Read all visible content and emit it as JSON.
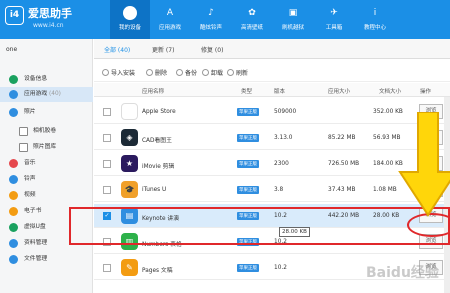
{
  "header": {
    "logo_mark": "i4",
    "brand": "爱思助手",
    "site": "www.i4.cn",
    "nav": [
      {
        "label": "我的设备",
        "icon": "apple-icon",
        "glyph": "",
        "active": true
      },
      {
        "label": "应用游戏",
        "icon": "app-store-icon",
        "glyph": "A",
        "active": false
      },
      {
        "label": "酷炫铃声",
        "icon": "bell-icon",
        "glyph": "♪",
        "active": false
      },
      {
        "label": "高清壁纸",
        "icon": "flower-icon",
        "glyph": "✿",
        "active": false
      },
      {
        "label": "刷机越狱",
        "icon": "box-icon",
        "glyph": "▣",
        "active": false
      },
      {
        "label": "工具箱",
        "icon": "toolbox-icon",
        "glyph": "✈",
        "active": false
      },
      {
        "label": "教程中心",
        "icon": "info-icon",
        "glyph": "i",
        "active": false
      }
    ]
  },
  "sidebar": {
    "device": "one",
    "items": [
      {
        "label": "设备信息",
        "count": "",
        "icon": "info-icon",
        "color": "#1aa15f",
        "sub": false,
        "selected": false
      },
      {
        "label": "应用游戏",
        "count": "(40)",
        "icon": "app-icon",
        "color": "#2f8ee0",
        "sub": false,
        "selected": true
      },
      {
        "label": "照片",
        "count": "",
        "icon": "photo-icon",
        "color": "#2f8ee0",
        "sub": false,
        "selected": false
      },
      {
        "label": "相机胶卷",
        "count": "",
        "icon": "camera-roll-icon",
        "color": "#fff",
        "sub": true,
        "selected": false
      },
      {
        "label": "照片图库",
        "count": "",
        "icon": "photo-library-icon",
        "color": "#fff",
        "sub": true,
        "selected": false
      },
      {
        "label": "音乐",
        "count": "",
        "icon": "music-icon",
        "color": "#e5484d",
        "sub": false,
        "selected": false
      },
      {
        "label": "铃声",
        "count": "",
        "icon": "ringtone-icon",
        "color": "#2f8ee0",
        "sub": false,
        "selected": false
      },
      {
        "label": "视频",
        "count": "",
        "icon": "video-icon",
        "color": "#f39c12",
        "sub": false,
        "selected": false
      },
      {
        "label": "电子书",
        "count": "",
        "icon": "ebook-icon",
        "color": "#f39c12",
        "sub": false,
        "selected": false
      },
      {
        "label": "虚拟U盘",
        "count": "",
        "icon": "udisk-icon",
        "color": "#1aa15f",
        "sub": false,
        "selected": false
      },
      {
        "label": "资料管理",
        "count": "",
        "icon": "contacts-icon",
        "color": "#2f8ee0",
        "sub": false,
        "selected": false
      },
      {
        "label": "文件管理",
        "count": "",
        "icon": "file-icon",
        "color": "#2f8ee0",
        "sub": false,
        "selected": false
      }
    ]
  },
  "tabs": [
    {
      "label": "全部 (40)",
      "active": true
    },
    {
      "label": "更新 (7)",
      "active": false
    },
    {
      "label": "修复 (0)",
      "active": false
    }
  ],
  "toolbar": [
    {
      "label": "导入安装",
      "icon": "import-icon"
    },
    {
      "label": "删除",
      "icon": "delete-icon"
    },
    {
      "label": "备份",
      "icon": "backup-icon"
    },
    {
      "label": "卸载",
      "icon": "uninstall-icon"
    },
    {
      "label": "刷新",
      "icon": "refresh-icon"
    }
  ],
  "table": {
    "headers": [
      "应用名称",
      "类型",
      "版本",
      "应用大小",
      "文档大小",
      "操作"
    ],
    "badge": "苹果正版",
    "rows": [
      {
        "name": "Apple Store",
        "version": "509000",
        "app_size": "",
        "doc_size": "352.00 KB",
        "action": "浏览",
        "icon_color": "#ffffff",
        "glyph": "",
        "checked": false,
        "highlight": false
      },
      {
        "name": "CAD看图王",
        "version": "3.13.0",
        "app_size": "85.22 MB",
        "doc_size": "56.93 MB",
        "action": "浏览",
        "icon_color": "#1c2a36",
        "glyph": "◈",
        "checked": false,
        "highlight": false
      },
      {
        "name": "iMovie 剪辑",
        "version": "2300",
        "app_size": "726.50 MB",
        "doc_size": "184.00 KB",
        "action": "浏览",
        "icon_color": "#2b1a5e",
        "glyph": "★",
        "checked": false,
        "highlight": false
      },
      {
        "name": "iTunes U",
        "version": "3.8",
        "app_size": "37.43 MB",
        "doc_size": "1.08 MB",
        "action": "浏览",
        "icon_color": "#f0a02a",
        "glyph": "🎓",
        "checked": false,
        "highlight": false
      },
      {
        "name": "Keynote 讲演",
        "version": "10.2",
        "app_size": "442.20 MB",
        "doc_size": "28.00 KB",
        "action": "浏览",
        "icon_color": "#2f8ee0",
        "glyph": "▤",
        "checked": true,
        "highlight": true
      },
      {
        "name": "Numbers 表格",
        "version": "10.2",
        "app_size": "",
        "doc_size": "",
        "action": "浏览",
        "icon_color": "#2db14a",
        "glyph": "▥",
        "checked": false,
        "highlight": false
      },
      {
        "name": "Pages 文稿",
        "version": "10.2",
        "app_size": "",
        "doc_size": "",
        "action": "浏览",
        "icon_color": "#f39c12",
        "glyph": "✎",
        "checked": false,
        "highlight": false
      }
    ]
  },
  "tooltip": "28.00 KB",
  "watermark": "Baidu经验"
}
